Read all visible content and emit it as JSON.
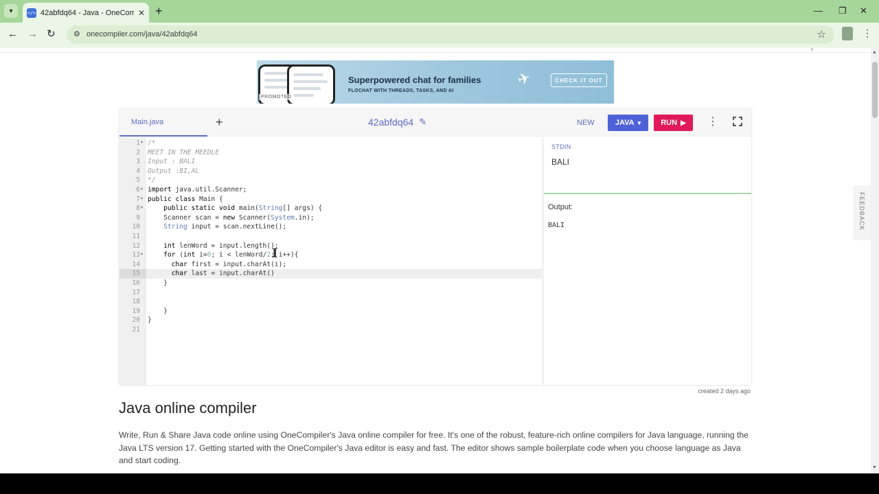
{
  "browser": {
    "tab_title": "42abfdq64 - Java - OneCompiler",
    "favicon_text": "</>",
    "new_tab": "+",
    "url": "onecompiler.com/java/42abfdq64"
  },
  "ad": {
    "promoted": "PROMOTED",
    "headline": "Superpowered chat for families",
    "subline": "FLOCHAT WITH THREADS, TASKS, AND AI",
    "cta": "CHECK IT OUT"
  },
  "editor": {
    "file_tab": "Main.java",
    "add_file": "+",
    "code_title": "42abfdq64",
    "new_label": "NEW",
    "language_label": "JAVA",
    "run_label": "RUN",
    "lines": [
      {
        "n": "1",
        "fold": true,
        "text": "/*",
        "cls": "comment"
      },
      {
        "n": "2",
        "fold": false,
        "text": "MEET IN THE MEEDLE",
        "cls": "comment"
      },
      {
        "n": "3",
        "fold": false,
        "text": "Input : BALI",
        "cls": "comment"
      },
      {
        "n": "4",
        "fold": false,
        "text": "Output :BI,AL",
        "cls": "comment"
      },
      {
        "n": "5",
        "fold": false,
        "text": "*/",
        "cls": "comment"
      },
      {
        "n": "6",
        "fold": true,
        "text": "import java.util.Scanner;",
        "cls": ""
      },
      {
        "n": "7",
        "fold": true,
        "text": "public class Main {",
        "cls": ""
      },
      {
        "n": "8",
        "fold": true,
        "text": "    public static void main(String[] args) {",
        "cls": ""
      },
      {
        "n": "9",
        "fold": false,
        "text": "    Scanner scan = new Scanner(System.in);",
        "cls": ""
      },
      {
        "n": "10",
        "fold": false,
        "text": "    String input = scan.nextLine();",
        "cls": ""
      },
      {
        "n": "11",
        "fold": false,
        "text": "",
        "cls": ""
      },
      {
        "n": "12",
        "fold": false,
        "text": "    int lenWord = input.length();",
        "cls": ""
      },
      {
        "n": "13",
        "fold": true,
        "text": "    for (int i=0; i < lenWord/2; i++){",
        "cls": ""
      },
      {
        "n": "14",
        "fold": false,
        "text": "      char first = input.charAt(i);",
        "cls": ""
      },
      {
        "n": "15",
        "fold": false,
        "text": "      char last = input.charAt()",
        "cls": ""
      },
      {
        "n": "16",
        "fold": false,
        "text": "    }",
        "cls": ""
      },
      {
        "n": "17",
        "fold": false,
        "text": "",
        "cls": ""
      },
      {
        "n": "18",
        "fold": false,
        "text": "",
        "cls": ""
      },
      {
        "n": "19",
        "fold": false,
        "text": "    }",
        "cls": ""
      },
      {
        "n": "20",
        "fold": false,
        "text": "}",
        "cls": ""
      },
      {
        "n": "21",
        "fold": false,
        "text": "",
        "cls": ""
      }
    ],
    "active_line": 15,
    "stdin_label": "STDIN",
    "stdin_value": "BALI",
    "output_label": "Output:",
    "output_value": "BALI",
    "created": "created 2 days ago"
  },
  "feedback": "FEEDBACK",
  "article": {
    "heading": "Java online compiler",
    "paragraph": "Write, Run & Share Java code online using OneCompiler's Java online compiler for free. It's one of the robust, feature-rich online compilers for Java language, running the Java LTS version 17. Getting started with the OneCompiler's Java editor is easy and fast. The editor shows sample boilerplate code when you choose language as Java and start coding."
  },
  "colors": {
    "accent": "#5c6bc0",
    "java_button": "#4e62d8",
    "run_button": "#e0195a",
    "chrome": "#a7d69a"
  }
}
